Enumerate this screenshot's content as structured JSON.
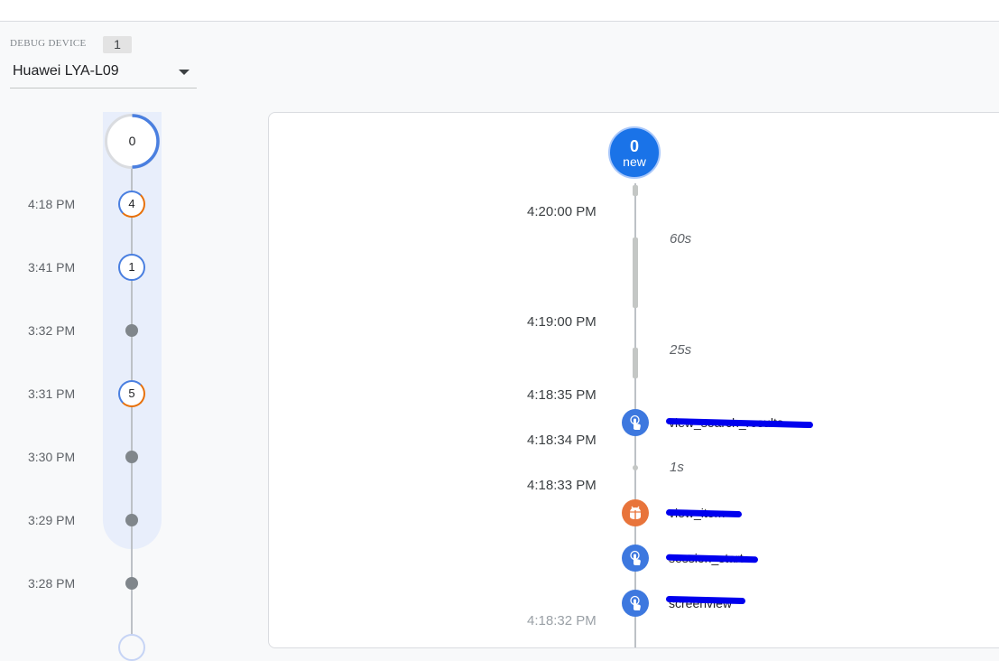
{
  "device": {
    "label": "DEBUG DEVICE",
    "count": "1",
    "selected": "Huawei LYA-L09"
  },
  "minutes": {
    "current_count": "0",
    "rows": [
      {
        "time": "4:18 PM",
        "count": "4",
        "kind": "mixed"
      },
      {
        "time": "3:41 PM",
        "count": "1",
        "kind": "blue"
      },
      {
        "time": "3:32 PM",
        "count": "",
        "kind": "dot"
      },
      {
        "time": "3:31 PM",
        "count": "5",
        "kind": "mixed"
      },
      {
        "time": "3:30 PM",
        "count": "",
        "kind": "dot"
      },
      {
        "time": "3:29 PM",
        "count": "",
        "kind": "dot"
      },
      {
        "time": "3:28 PM",
        "count": "",
        "kind": "dot"
      }
    ]
  },
  "seconds": {
    "new_count": "0",
    "new_label": "new",
    "times": [
      "4:20:00 PM",
      "4:19:00 PM",
      "4:18:35 PM",
      "4:18:34 PM",
      "4:18:33 PM",
      "4:18:32 PM"
    ],
    "gaps": [
      "60s",
      "25s",
      "1s"
    ],
    "events": [
      {
        "name": "view_search_results",
        "icon": "touch-icon",
        "color": "#3d78df"
      },
      {
        "name": "view_item",
        "icon": "android-bug-icon",
        "color": "#e8743b"
      },
      {
        "name": "session_start",
        "icon": "touch-icon",
        "color": "#3d78df"
      },
      {
        "name": "screenview",
        "icon": "touch-icon",
        "color": "#3d78df"
      }
    ]
  },
  "colors": {
    "accent": "#1a73e8",
    "highlight": "#e8eefb",
    "warning": "#e8710a",
    "redaction": "#0000ee"
  }
}
